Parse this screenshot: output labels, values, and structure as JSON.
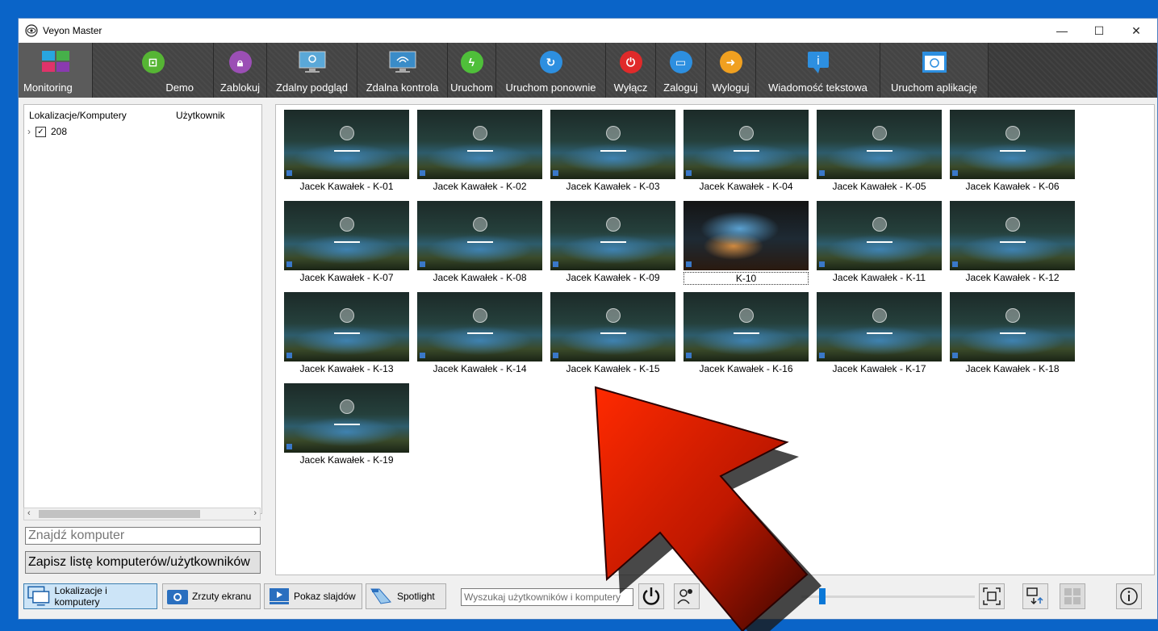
{
  "window": {
    "title": "Veyon Master",
    "minimize": "—",
    "maximize": "☐",
    "close": "✕"
  },
  "toolbar": [
    {
      "label": "Monitoring",
      "name": "monitoring"
    },
    {
      "label": "Demo",
      "name": "demo"
    },
    {
      "label": "Zablokuj",
      "name": "zablokuj"
    },
    {
      "label": "Zdalny podgląd",
      "name": "zdalny-podglad"
    },
    {
      "label": "Zdalna kontrola",
      "name": "zdalna-kontrola"
    },
    {
      "label": "Uruchom",
      "name": "uruchom"
    },
    {
      "label": "Uruchom ponownie",
      "name": "uruchom-ponownie"
    },
    {
      "label": "Wyłącz",
      "name": "wylacz"
    },
    {
      "label": "Zaloguj",
      "name": "zaloguj"
    },
    {
      "label": "Wyloguj",
      "name": "wyloguj"
    },
    {
      "label": "Wiadomość tekstowa",
      "name": "wiadomosc-tekstowa"
    },
    {
      "label": "Uruchom aplikację",
      "name": "uruchom-aplikacje"
    }
  ],
  "tree": {
    "col1": "Lokalizacje/Komputery",
    "col2": "Użytkownik",
    "root": "208"
  },
  "left": {
    "find_placeholder": "Znajdź komputer",
    "save_button": "Zapisz listę komputerów/użytkowników"
  },
  "computers": [
    "Jacek Kawałek - K-01",
    "Jacek Kawałek - K-02",
    "Jacek Kawałek - K-03",
    "Jacek Kawałek - K-04",
    "Jacek Kawałek - K-05",
    "Jacek Kawałek - K-06",
    "Jacek Kawałek - K-07",
    "Jacek Kawałek - K-08",
    "Jacek Kawałek - K-09",
    "K-10",
    "Jacek Kawałek - K-11",
    "Jacek Kawałek - K-12",
    "Jacek Kawałek - K-13",
    "Jacek Kawałek - K-14",
    "Jacek Kawałek - K-15",
    "Jacek Kawałek - K-16",
    "Jacek Kawałek - K-17",
    "Jacek Kawałek - K-18",
    "Jacek Kawałek - K-19"
  ],
  "bottom": {
    "tab_locations": "Lokalizacje i komputery",
    "tab_screenshots": "Zrzuty ekranu",
    "tab_slideshow": "Pokaz slajdów",
    "tab_spotlight": "Spotlight",
    "search_placeholder": "Wyszukaj użytkowników i komputery"
  },
  "colors": {
    "accent": "#0a78d7",
    "toolbar": "#3a3a3a",
    "arrow": "#e02000"
  }
}
